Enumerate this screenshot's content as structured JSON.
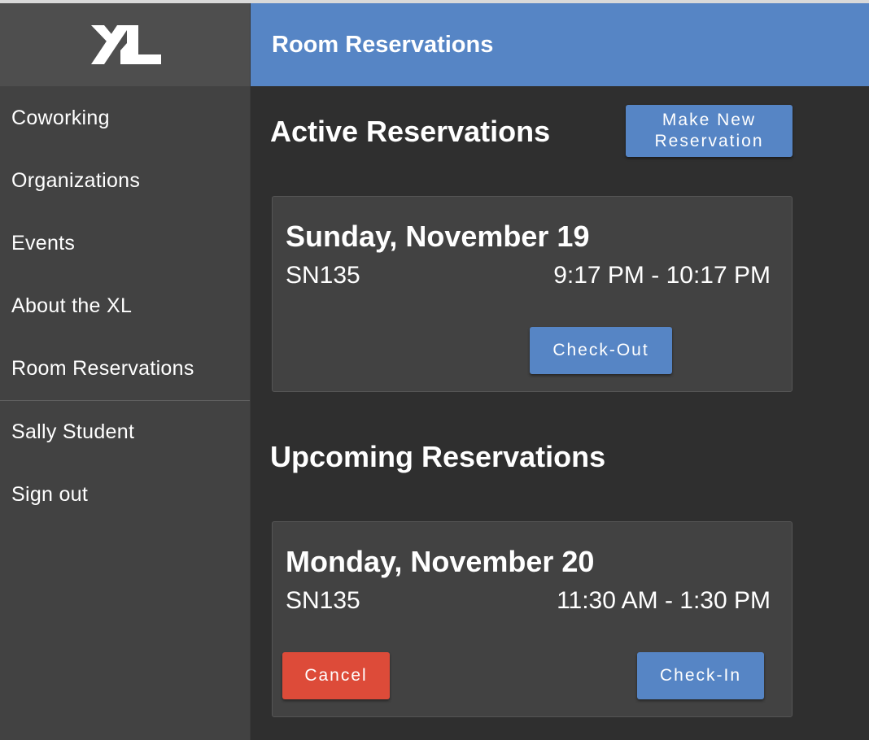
{
  "brand": {
    "logo_text": "XL"
  },
  "header": {
    "title": "Room Reservations"
  },
  "sidebar": {
    "items": [
      {
        "label": "Coworking"
      },
      {
        "label": "Organizations"
      },
      {
        "label": "Events"
      },
      {
        "label": "About the XL"
      },
      {
        "label": "Room Reservations"
      }
    ],
    "user_items": [
      {
        "label": "Sally Student"
      },
      {
        "label": "Sign out"
      }
    ]
  },
  "active": {
    "title": "Active Reservations",
    "new_button": "Make New Reservation",
    "reservation": {
      "date": "Sunday, November 19",
      "room": "SN135",
      "time": "9:17 PM - 10:17 PM",
      "checkout_label": "Check-Out"
    }
  },
  "upcoming": {
    "title": "Upcoming Reservations",
    "reservation": {
      "date": "Monday, November 20",
      "room": "SN135",
      "time": "11:30 AM - 1:30 PM",
      "cancel_label": "Cancel",
      "checkin_label": "Check-In"
    }
  },
  "colors": {
    "accent": "#5685c5",
    "danger": "#dd4b39",
    "sidebar": "#424242",
    "background": "#2f2f2f"
  }
}
